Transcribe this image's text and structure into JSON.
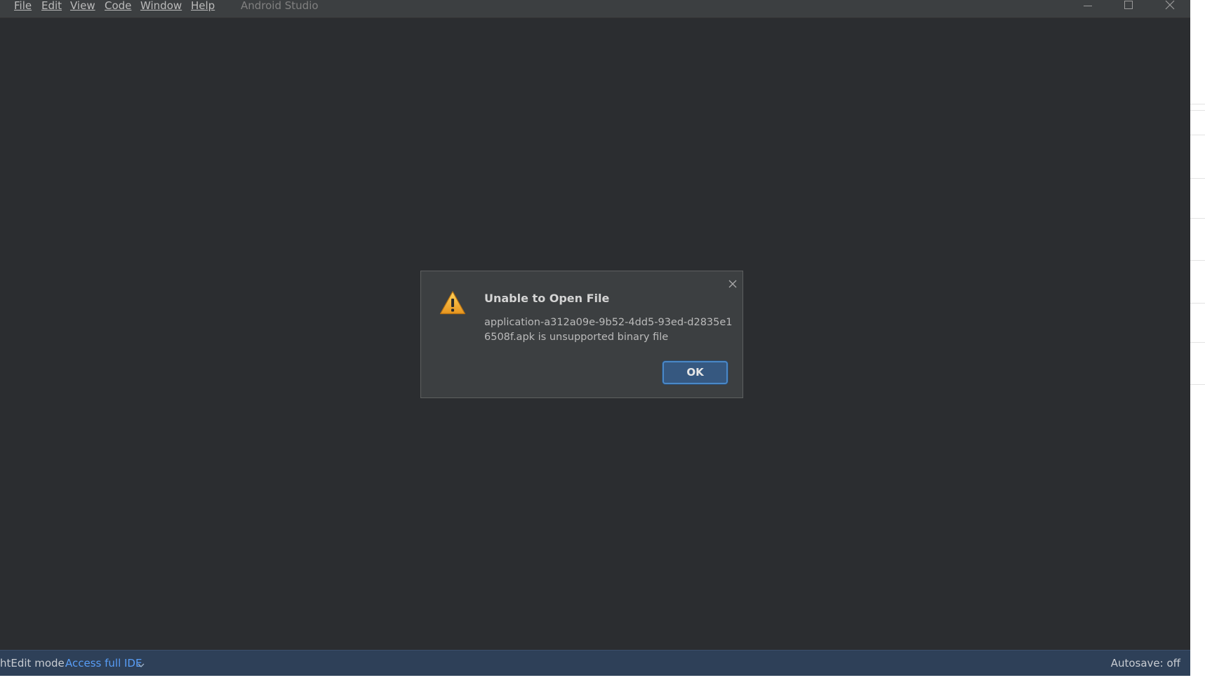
{
  "menu": {
    "items": [
      {
        "label": "File"
      },
      {
        "label": "Edit"
      },
      {
        "label": "View"
      },
      {
        "label": "Code"
      },
      {
        "label": "Window"
      },
      {
        "label": "Help"
      }
    ]
  },
  "window": {
    "title": "Android Studio",
    "controls": [
      "minimize-icon",
      "maximize-icon",
      "close-icon"
    ]
  },
  "dialog": {
    "title": "Unable to Open File",
    "message": "application-a312a09e-9b52-4dd5-93ed-d2835e16508f.apk is unsupported binary file",
    "ok_label": "OK",
    "icon": "warning-icon",
    "close_icon": "close-icon"
  },
  "status_bar": {
    "mode_text": "htEdit mode.",
    "access_link": "Access full IDE",
    "access_icon": "chevron-down-icon",
    "autosave": "Autosave: off"
  },
  "colors": {
    "background": "#2b2d30",
    "title_bar": "#3c3f41",
    "status_bar": "#2e4058",
    "link": "#589df6",
    "ok_button": "#365880",
    "warning": "#f0a732"
  }
}
